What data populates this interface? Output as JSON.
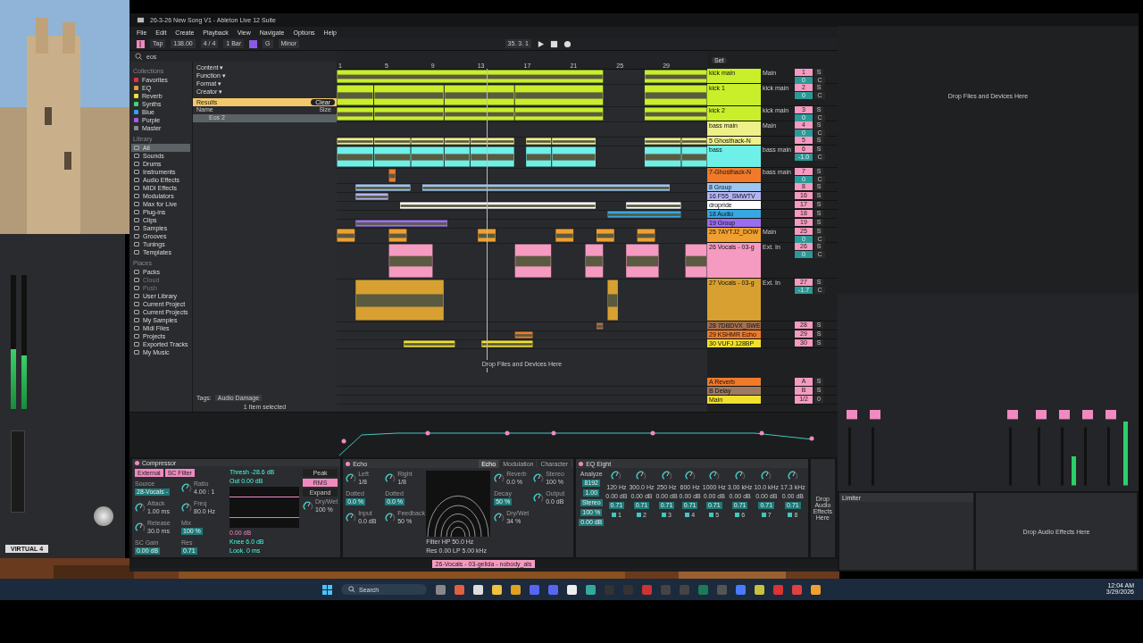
{
  "plugin_window": {
    "label": "VIRTUAL 4",
    "meters": [
      {
        "level": 0.45
      },
      {
        "level": 0.4
      }
    ]
  },
  "window": {
    "title": "26-3-26 New Song V1 - Ableton Live 12 Suite",
    "menu": [
      "File",
      "Edit",
      "Create",
      "Playback",
      "View",
      "Navigate",
      "Options",
      "Help"
    ]
  },
  "toolbar": {
    "tap": "Tap",
    "tempo": "138.00",
    "signature": "4 / 4",
    "quantize": "1 Bar",
    "key": "G",
    "scale": "Minor",
    "position": "35. 3. 1"
  },
  "browser": {
    "search": "eos",
    "collections_heading": "Collections",
    "collections": [
      {
        "label": "Favorites",
        "color": "#e0314b"
      },
      {
        "label": "EQ",
        "color": "#e39a3a"
      },
      {
        "label": "Reverb",
        "color": "#e8e23a"
      },
      {
        "label": "Synths",
        "color": "#3ed67c"
      },
      {
        "label": "Blue",
        "color": "#3a9ee8"
      },
      {
        "label": "Purple",
        "color": "#a35ee8"
      },
      {
        "label": "Master",
        "color": "#8a8a8a"
      }
    ],
    "library_heading": "Library",
    "library": [
      {
        "label": "All",
        "selected": true
      },
      {
        "label": "Sounds",
        "selected": false
      },
      {
        "label": "Drums",
        "selected": false
      },
      {
        "label": "Instruments",
        "selected": false
      },
      {
        "label": "Audio Effects",
        "selected": false
      },
      {
        "label": "MIDI Effects",
        "selected": false
      },
      {
        "label": "Modulators",
        "selected": false
      },
      {
        "label": "Max for Live",
        "selected": false
      },
      {
        "label": "Plug-ins",
        "selected": false
      },
      {
        "label": "Clips",
        "selected": false
      },
      {
        "label": "Samples",
        "selected": false
      },
      {
        "label": "Grooves",
        "selected": false
      },
      {
        "label": "Tunings",
        "selected": false
      },
      {
        "label": "Templates",
        "selected": false
      }
    ],
    "places_heading": "Places",
    "places": [
      {
        "label": "Packs",
        "disabled": false
      },
      {
        "label": "Cloud",
        "disabled": true
      },
      {
        "label": "Push",
        "disabled": true
      },
      {
        "label": "User Library",
        "disabled": false
      },
      {
        "label": "Current Project",
        "disabled": false
      },
      {
        "label": "Current Projects",
        "disabled": false
      },
      {
        "label": "My Samples",
        "disabled": false
      },
      {
        "label": "Midi Files",
        "disabled": false
      },
      {
        "label": "Projects",
        "disabled": false
      },
      {
        "label": "Exported Tracks",
        "disabled": false
      },
      {
        "label": "My Music",
        "disabled": false
      }
    ],
    "filters": [
      "Content ▾",
      "Function ▾",
      "Format ▾",
      "Creator ▾"
    ],
    "results_label": "Results",
    "clear": "Clear",
    "columns": [
      "Name",
      "Size"
    ],
    "results": [
      {
        "name": "Eos 2",
        "selected": true
      }
    ],
    "tags_label": "Tags:",
    "tag": "Audio Damage",
    "status": "1 Item selected"
  },
  "arrangement": {
    "ruler": [
      "1",
      "5",
      "9",
      "13",
      "17",
      "21",
      "25",
      "29"
    ],
    "set": "Set",
    "drop_hint": "Drop Files and Devices Here",
    "tracks": [
      {
        "name": "kick main",
        "color": "#c8ef2a",
        "kind": "normal",
        "routing": "Main",
        "number": "1",
        "solo": "S",
        "volume": "0",
        "pan": "C"
      },
      {
        "name": "kick 1",
        "color": "#c8ef2a",
        "kind": "medium",
        "routing": "kick main",
        "number": "2",
        "solo": "S",
        "volume": "0",
        "pan": "C"
      },
      {
        "name": "kick 2",
        "color": "#c8ef2a",
        "kind": "normal",
        "routing": "kick main",
        "number": "3",
        "solo": "S",
        "volume": "0",
        "pan": "C"
      },
      {
        "name": "bass main",
        "color": "#eef08a",
        "kind": "normal",
        "routing": "Main",
        "number": "4",
        "solo": "S",
        "volume": "0",
        "pan": "C"
      },
      {
        "name": "5 Ghosthack-N",
        "color": "#eef08a",
        "kind": "compact",
        "number": "5",
        "solo": "S"
      },
      {
        "name": "bass",
        "color": "#6ef0e8",
        "kind": "medium",
        "routing": "bass main",
        "number": "6",
        "solo": "S",
        "volume": "-1.0",
        "pan": "C"
      },
      {
        "name": "7-Ghosthack-N",
        "color": "#f07a2a",
        "kind": "normal",
        "routing": "bass main",
        "number": "7",
        "solo": "S",
        "volume": "0",
        "pan": "C"
      },
      {
        "name": "8 Group",
        "color": "#9cc6f0",
        "kind": "compact",
        "number": "8",
        "solo": "S"
      },
      {
        "name": "16 F55_SMWTV",
        "color": "#b4b4f4",
        "kind": "compact",
        "number": "16",
        "solo": "S"
      },
      {
        "name": "dropride",
        "color": "#ffffff",
        "kind": "compact",
        "number": "17",
        "solo": "S"
      },
      {
        "name": "18 Audio",
        "color": "#36a8e0",
        "kind": "compact",
        "number": "18",
        "solo": "S"
      },
      {
        "name": "19 Group",
        "color": "#9a6ef0",
        "kind": "compact",
        "number": "19",
        "solo": "S"
      },
      {
        "name": "25 7AYTJ2_DOW",
        "color": "#f0a030",
        "kind": "normal",
        "routing": "Main",
        "number": "25",
        "solo": "S",
        "volume": "0",
        "pan": "C"
      },
      {
        "name": "26 Vocals - 03-g",
        "color": "#f59ac0",
        "kind": "large",
        "routing": "Ext. In",
        "number": "26",
        "solo": "S",
        "volume": "0",
        "pan": "C"
      },
      {
        "name": "27 Vocals - 03-g",
        "color": "#d8a030",
        "kind": "xlarge",
        "routing": "Ext. In",
        "number": "27",
        "solo": "S",
        "volume": "-1.7",
        "pan": "C"
      },
      {
        "name": "28 7DBDVX_SWE",
        "color": "#a07050",
        "kind": "compact",
        "number": "28",
        "solo": "S"
      },
      {
        "name": "29 KSHMR Echo",
        "color": "#f07a2a",
        "kind": "compact",
        "number": "29",
        "solo": "S"
      },
      {
        "name": "30 VUFJ 128BP",
        "color": "#f0e030",
        "kind": "compact",
        "number": "30",
        "solo": "S"
      }
    ],
    "returns": [
      {
        "name": "A Reverb",
        "color": "#f07a2a",
        "number": "A",
        "solo": "S"
      },
      {
        "name": "B Delay",
        "color": "#a07a60",
        "number": "B",
        "solo": "S"
      },
      {
        "name": "Main",
        "color": "#f0e030",
        "number": "1/2",
        "solo": "0"
      }
    ]
  },
  "compressor": {
    "title": "Compressor",
    "toggles": [
      {
        "label": "External",
        "on": true
      },
      {
        "label": "SC Filter",
        "on": true
      }
    ],
    "controls": [
      {
        "kind": "value",
        "label": "Source",
        "value": "28-Vocals -"
      },
      {
        "kind": "knob",
        "label": "Ratio",
        "value": "4.00 : 1"
      },
      {
        "kind": "knob",
        "label": "Attack",
        "value": "1.00 ms"
      },
      {
        "kind": "knob",
        "label": "Freq",
        "value": "80.0 Hz"
      },
      {
        "kind": "knob",
        "label": "Release",
        "value": "30.0 ms"
      },
      {
        "kind": "value",
        "label": "Mix",
        "value": "100 %"
      },
      {
        "kind": "value",
        "label": "SC Gain",
        "value": "0.00 dB"
      },
      {
        "kind": "value",
        "label": "Res",
        "value": "0.71"
      }
    ],
    "threshold": "Thresh -28.6 dB",
    "out": "Out 0.00 dB",
    "graph_value": "0.00 dB",
    "knee": "Knee 6.0 dB",
    "look": "Look. 0 ms",
    "modes": [
      {
        "label": "Peak",
        "selected": false
      },
      {
        "label": "RMS",
        "selected": true
      },
      {
        "label": "Expand",
        "selected": false
      }
    ],
    "drywet": {
      "label": "Dry/Wet",
      "value": "100 %"
    }
  },
  "echo": {
    "title": "Echo",
    "tabs": [
      {
        "label": "Echo",
        "selected": true
      },
      {
        "label": "Modulation",
        "selected": false
      },
      {
        "label": "Character",
        "selected": false
      }
    ],
    "controls": [
      {
        "kind": "knob",
        "label": "Left",
        "value": "1/8"
      },
      {
        "kind": "knob",
        "label": "Right",
        "value": "1/8"
      },
      {
        "kind": "value",
        "label": "Dotted",
        "value": "0.0 %"
      },
      {
        "kind": "value",
        "label": "Dotted",
        "value": "0.0 %"
      },
      {
        "kind": "knob",
        "label": "Input",
        "value": "0.0 dB"
      },
      {
        "kind": "knob",
        "label": "Feedback",
        "value": "50 %"
      }
    ],
    "side": [
      {
        "kind": "knob",
        "label": "Reverb",
        "value": "0.0 %"
      },
      {
        "kind": "knob",
        "label": "Stereo",
        "value": "100 %"
      },
      {
        "kind": "value",
        "label": "Decay",
        "value": "50 %"
      },
      {
        "kind": "knob",
        "label": "Output",
        "value": "0.0 dB"
      },
      {
        "kind": "knob",
        "label": "Dry/Wet",
        "value": "34 %"
      }
    ],
    "filter": "Filter HP 50.0 Hz",
    "filter_res": "Res 0.00 LP 5.00 kHz"
  },
  "eq": {
    "title": "EQ Eight",
    "analyze": "Analyze",
    "block": "8192",
    "avg": "1.00",
    "bands": [
      {
        "freq": "120 Hz",
        "gain": "0.00 dB",
        "q": "0.71",
        "number": "1"
      },
      {
        "freq": "300.0 Hz",
        "gain": "0.00 dB",
        "q": "0.71",
        "number": "2"
      },
      {
        "freq": "250 Hz",
        "gain": "0.00 dB",
        "q": "0.71",
        "number": "3"
      },
      {
        "freq": "600 Hz",
        "gain": "0.00 dB",
        "q": "0.71",
        "number": "4"
      },
      {
        "freq": "1000 Hz",
        "gain": "0.00 dB",
        "q": "0.71",
        "number": "5"
      },
      {
        "freq": "3.00 kHz",
        "gain": "0.00 dB",
        "q": "0.71",
        "number": "6"
      },
      {
        "freq": "10.0 kHz",
        "gain": "0.00 dB",
        "q": "0.71",
        "number": "7"
      },
      {
        "freq": "17.3 kHz",
        "gain": "0.00 dB",
        "q": "0.71",
        "number": "8"
      }
    ],
    "mode": "Stereo",
    "scale": "100 %",
    "gain": "0.00 dB"
  },
  "drop_effects": "Drop Audio Effects Here",
  "clip_status": "26-Vocals - 03-gelida - nobody_als",
  "right_window": {
    "hint": "Drop Files and Devices Here",
    "device": "Limiter",
    "effects_hint": "Drop Audio Effects Here"
  },
  "taskbar": {
    "search": "Search",
    "time": "12:04 AM",
    "date": "3/29/2026"
  }
}
